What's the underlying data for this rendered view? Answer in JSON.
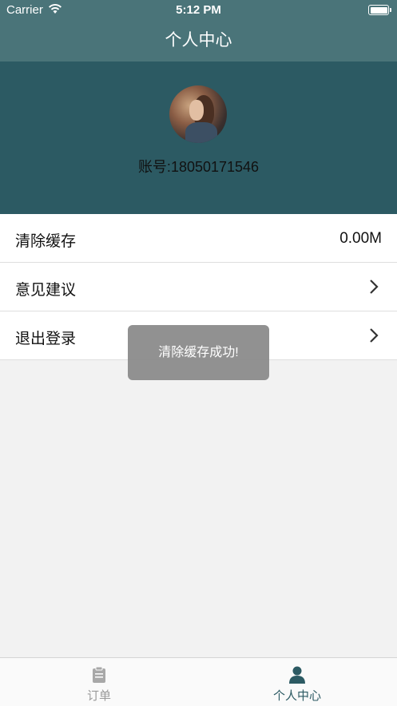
{
  "status_bar": {
    "carrier": "Carrier",
    "time": "5:12 PM"
  },
  "nav": {
    "title": "个人中心"
  },
  "profile": {
    "account": "账号:18050171546"
  },
  "menu": [
    {
      "label": "清除缓存",
      "value": "0.00M"
    },
    {
      "label": "意见建议"
    },
    {
      "label": "退出登录"
    }
  ],
  "toast": {
    "message": "清除缓存成功!"
  },
  "tabs": [
    {
      "label": "订单",
      "icon": "clipboard-icon",
      "active": false
    },
    {
      "label": "个人中心",
      "icon": "person-icon",
      "active": true
    }
  ],
  "colors": {
    "header": "#4a7479",
    "profile_bg": "#2c5a63",
    "active_tab": "#2c5a63",
    "inactive_tab": "#9a9a9a"
  }
}
